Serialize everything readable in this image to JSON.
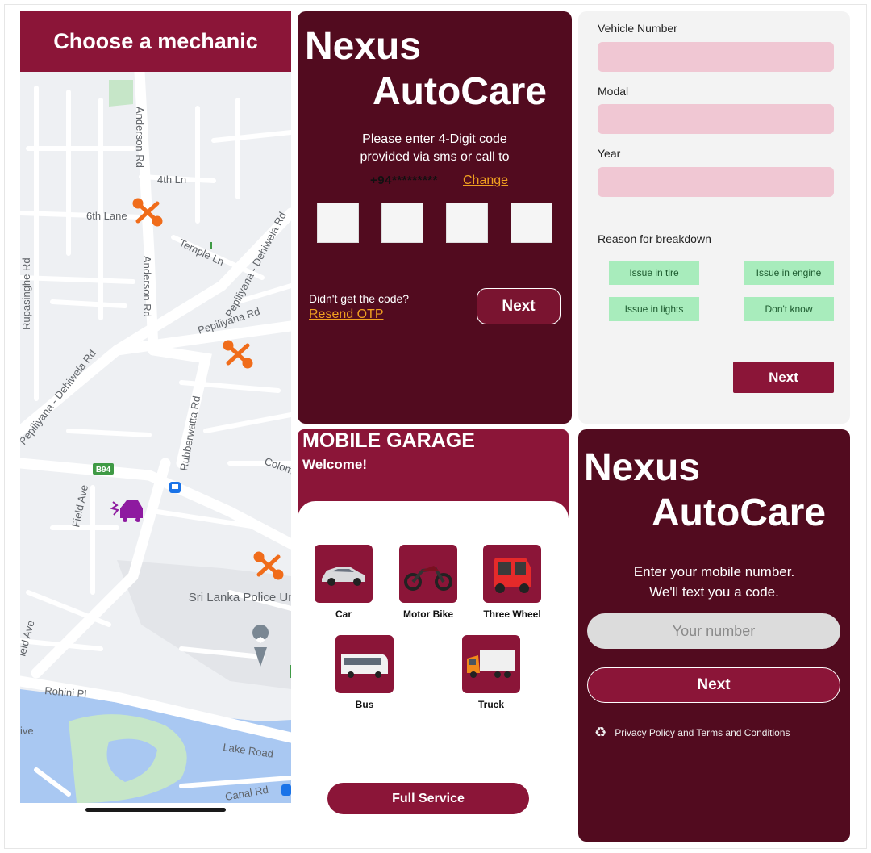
{
  "map_screen": {
    "title": "Choose a mechanic",
    "streets": [
      "Anderson Rd",
      "4th Ln",
      "6th Lane",
      "Temple Ln",
      "Pepiliyana - Dehiwela Rd",
      "Rupasinghe Rd",
      "Anderson Rd",
      "Pepiliyana Rd",
      "Pepiliyana - Dehiwela Rd",
      "Rubberwatta Rd",
      "Field Ave",
      "Colombo",
      "Rohini Pl",
      "Lake Road",
      "Canal Rd",
      "ield Ave",
      "ive"
    ],
    "route_badge": "B94",
    "poi": "Sri Lanka Police University",
    "colors": {
      "header": "#8b1538",
      "mechanic": "#f06c1a",
      "car": "#8e1aa0",
      "water": "#a9c8f2",
      "park": "#c6e6c8"
    }
  },
  "otp_screen": {
    "brand_line1": "Nexus",
    "brand_line2": "AutoCare",
    "instruction_line1": "Please enter 4-Digit code",
    "instruction_line2": "provided via sms or call to",
    "phone": "+94*********",
    "change_link": "Change",
    "didnt_get": "Didn't get the code?",
    "resend_link": "Resend OTP",
    "next_button": "Next",
    "digits": [
      "",
      "",
      "",
      ""
    ]
  },
  "vehicle_form": {
    "vehicle_number_label": "Vehicle Number",
    "model_label": "Modal",
    "year_label": "Year",
    "reason_label": "Reason for breakdown",
    "reasons": [
      "Issue in tire",
      "Issue in engine",
      "Issue in lights",
      "Don't know"
    ],
    "next_button": "Next"
  },
  "garage_screen": {
    "title": "MOBILE GARAGE",
    "welcome": "Welcome!",
    "vehicles": [
      {
        "label": "Car",
        "icon": "car-icon"
      },
      {
        "label": "Motor Bike",
        "icon": "motorbike-icon"
      },
      {
        "label": "Three Wheel",
        "icon": "three-wheel-icon"
      },
      {
        "label": "Bus",
        "icon": "bus-icon"
      },
      {
        "label": "Truck",
        "icon": "truck-icon"
      }
    ],
    "full_service_button": "Full Service"
  },
  "login_screen": {
    "brand_line1": "Nexus",
    "brand_line2": "AutoCare",
    "instruction_line1": "Enter your mobile number.",
    "instruction_line2": "We'll text you a code.",
    "phone_placeholder": "Your number",
    "next_button": "Next",
    "privacy_text": "Privacy Policy and Terms and Conditions"
  }
}
